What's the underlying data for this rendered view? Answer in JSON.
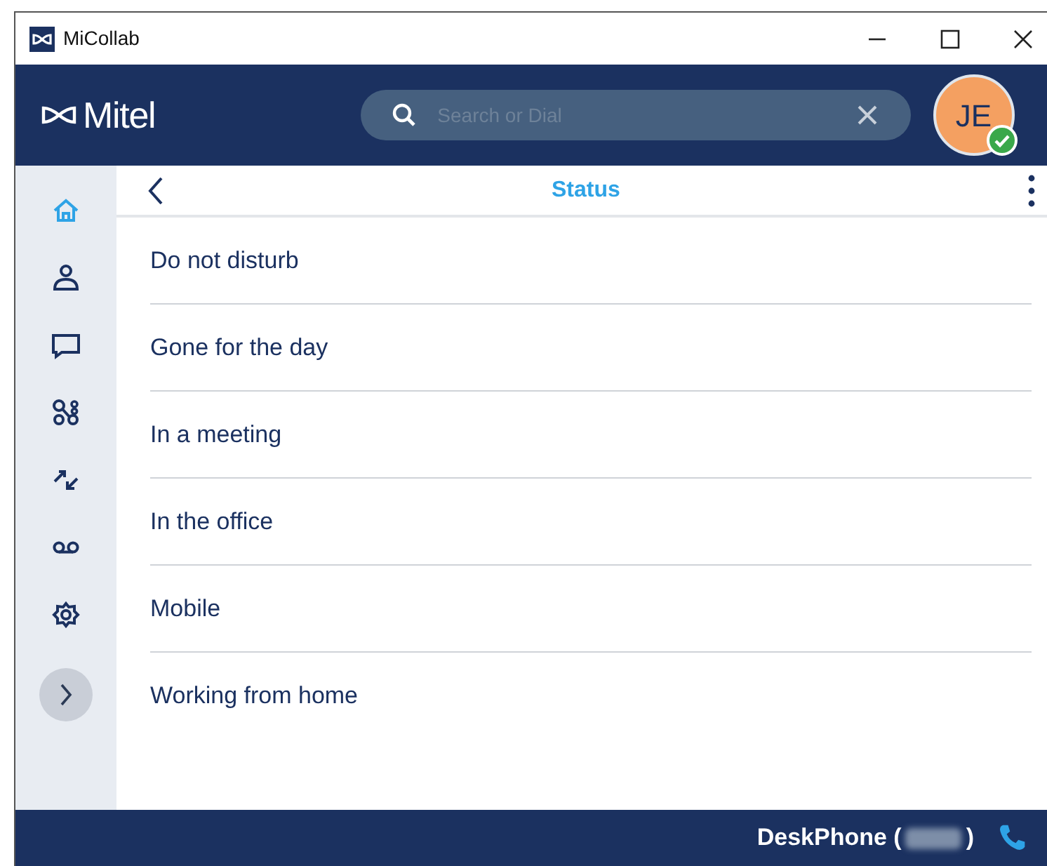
{
  "window": {
    "title": "MiCollab"
  },
  "header": {
    "logo_text": "Mitel",
    "search": {
      "placeholder": "Search or Dial"
    },
    "avatar": {
      "initials": "JE",
      "available": true
    }
  },
  "sidebar": {
    "items": [
      {
        "kind": "home",
        "selected": true
      },
      {
        "kind": "contacts",
        "selected": false
      },
      {
        "kind": "chat",
        "selected": false
      },
      {
        "kind": "groups",
        "selected": false
      },
      {
        "kind": "calls",
        "selected": false
      },
      {
        "kind": "voicemail",
        "selected": false
      },
      {
        "kind": "settings",
        "selected": false
      }
    ]
  },
  "page": {
    "title": "Status"
  },
  "statuses": [
    {
      "label": "Do not disturb"
    },
    {
      "label": "Gone for the day"
    },
    {
      "label": "In a meeting"
    },
    {
      "label": "In the office"
    },
    {
      "label": "Mobile"
    },
    {
      "label": "Working from home"
    }
  ],
  "status_bar": {
    "device_prefix": "DeskPhone (",
    "device_suffix": ")"
  }
}
